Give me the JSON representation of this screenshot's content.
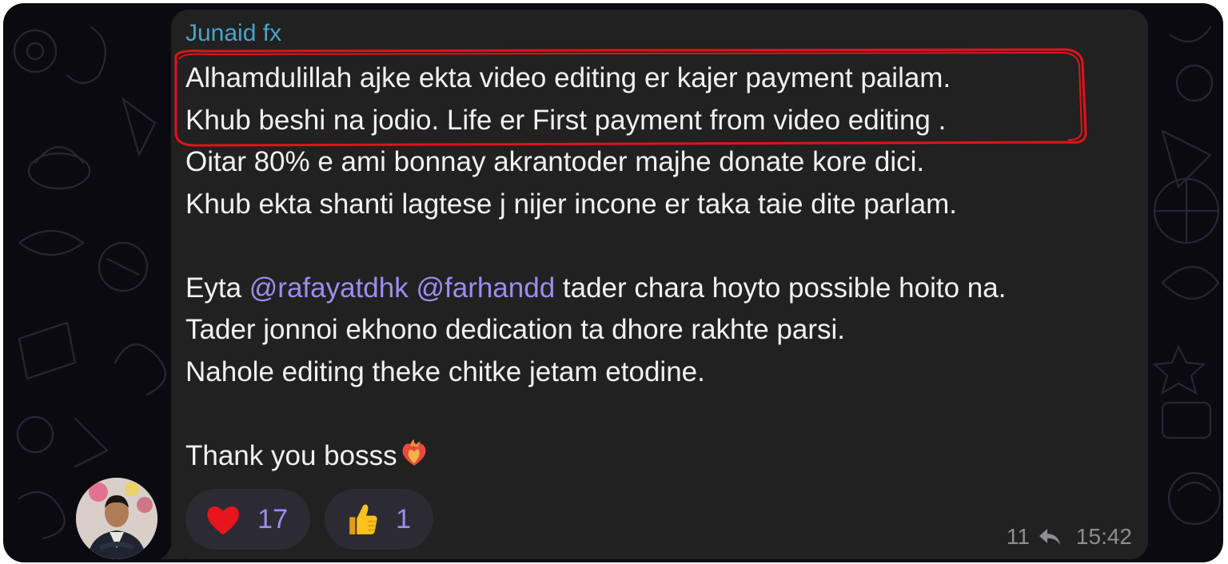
{
  "message": {
    "sender": "Junaid fx",
    "lines": [
      {
        "text": "Alhamdulillah ajke ekta video editing er kajer payment pailam."
      },
      {
        "text": "Khub beshi na jodio. Life er First payment from video editing ."
      },
      {
        "text": "Oitar 80% e ami bonnay akrantoder majhe donate kore dici."
      },
      {
        "text": "Khub ekta shanti lagtese j nijer incone er taka taie dite parlam."
      },
      {
        "text": ""
      },
      {
        "pre": "Eyta ",
        "mention1": "@rafayatdhk",
        "sep": " ",
        "mention2": "@farhandd",
        "post": " tader chara hoyto possible hoito na."
      },
      {
        "text": "Tader jonnoi ekhono dedication ta dhore rakhte parsi."
      },
      {
        "text": "Nahole editing theke chitke jetam etodine."
      },
      {
        "text": ""
      },
      {
        "text": "Thank you bosss"
      }
    ],
    "reactions": [
      {
        "icon": "heart-icon",
        "count": "17"
      },
      {
        "icon": "thumbs-up-icon",
        "count": "1"
      }
    ],
    "replies": "11",
    "time": "15:42"
  },
  "colors": {
    "bubble": "#212121",
    "sender": "#4aa3c9",
    "mention": "#9a8ef0",
    "highlight": "#e0131a"
  }
}
